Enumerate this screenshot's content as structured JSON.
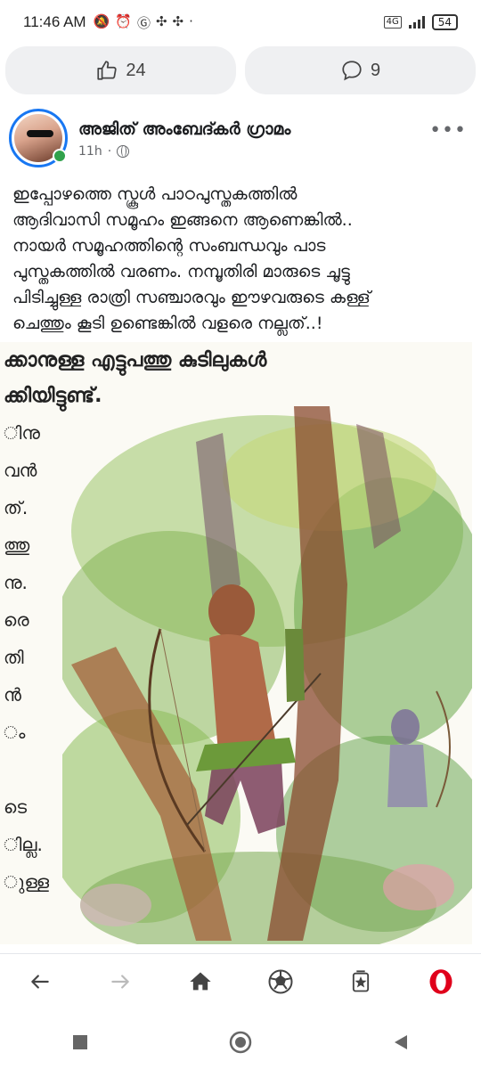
{
  "status_bar": {
    "time": "11:46 AM",
    "network": "4G",
    "battery": "54"
  },
  "reactions": {
    "like_count": "24",
    "comment_count": "9"
  },
  "post": {
    "author": "അജിത് അംബേദ്കർ ഗ്രാമം",
    "time": "11h",
    "more": "•••",
    "text_lines": [
      "ഇപ്പോഴത്തെ സ്കൂൾ പാഠപുസ്തകത്തിൽ",
      "ആദിവാസി സമൂഹം ഇങ്ങനെ ആണെങ്കിൽ..",
      "നായർ സമൂഹത്തിന്റെ സംബന്ധവും പാട",
      "പുസ്തകത്തിൽ വരണം. നമ്പൂതിരി മാരുടെ ചൂട്ടു",
      "പിടിച്ചുള്ള രാത്രി സഞ്ചാരവും ഈഴവരുടെ കള്ള്",
      "ചെത്തും കൂടി ഉണ്ടെങ്കിൽ വളരെ നല്ലത്..!"
    ]
  },
  "image": {
    "top_line": "ക്കാനുള്ള  എട്ടുപത്തു  കുടിലുകൾ",
    "second_line": "ക്കിയിട്ടുണ്ട്.",
    "side_fragments": [
      "ിനു",
      "വൻ",
      "ത്.",
      "ത്തു",
      "നു.",
      "രെ",
      "തി",
      "ൻ",
      "ം",
      "",
      "ടെ",
      "ില്ല.",
      "ുള്ള"
    ]
  },
  "icons": {
    "like": "thumbs-up-icon",
    "comment": "comment-bubble-icon",
    "back": "back-arrow-icon",
    "forward": "forward-arrow-icon",
    "home": "home-icon",
    "ball": "soccer-ball-icon",
    "tabs": "tabs-icon",
    "opera": "opera-logo-icon"
  },
  "colors": {
    "accent": "#1877f2",
    "online": "#31a24c",
    "opera": "#e0001b"
  }
}
